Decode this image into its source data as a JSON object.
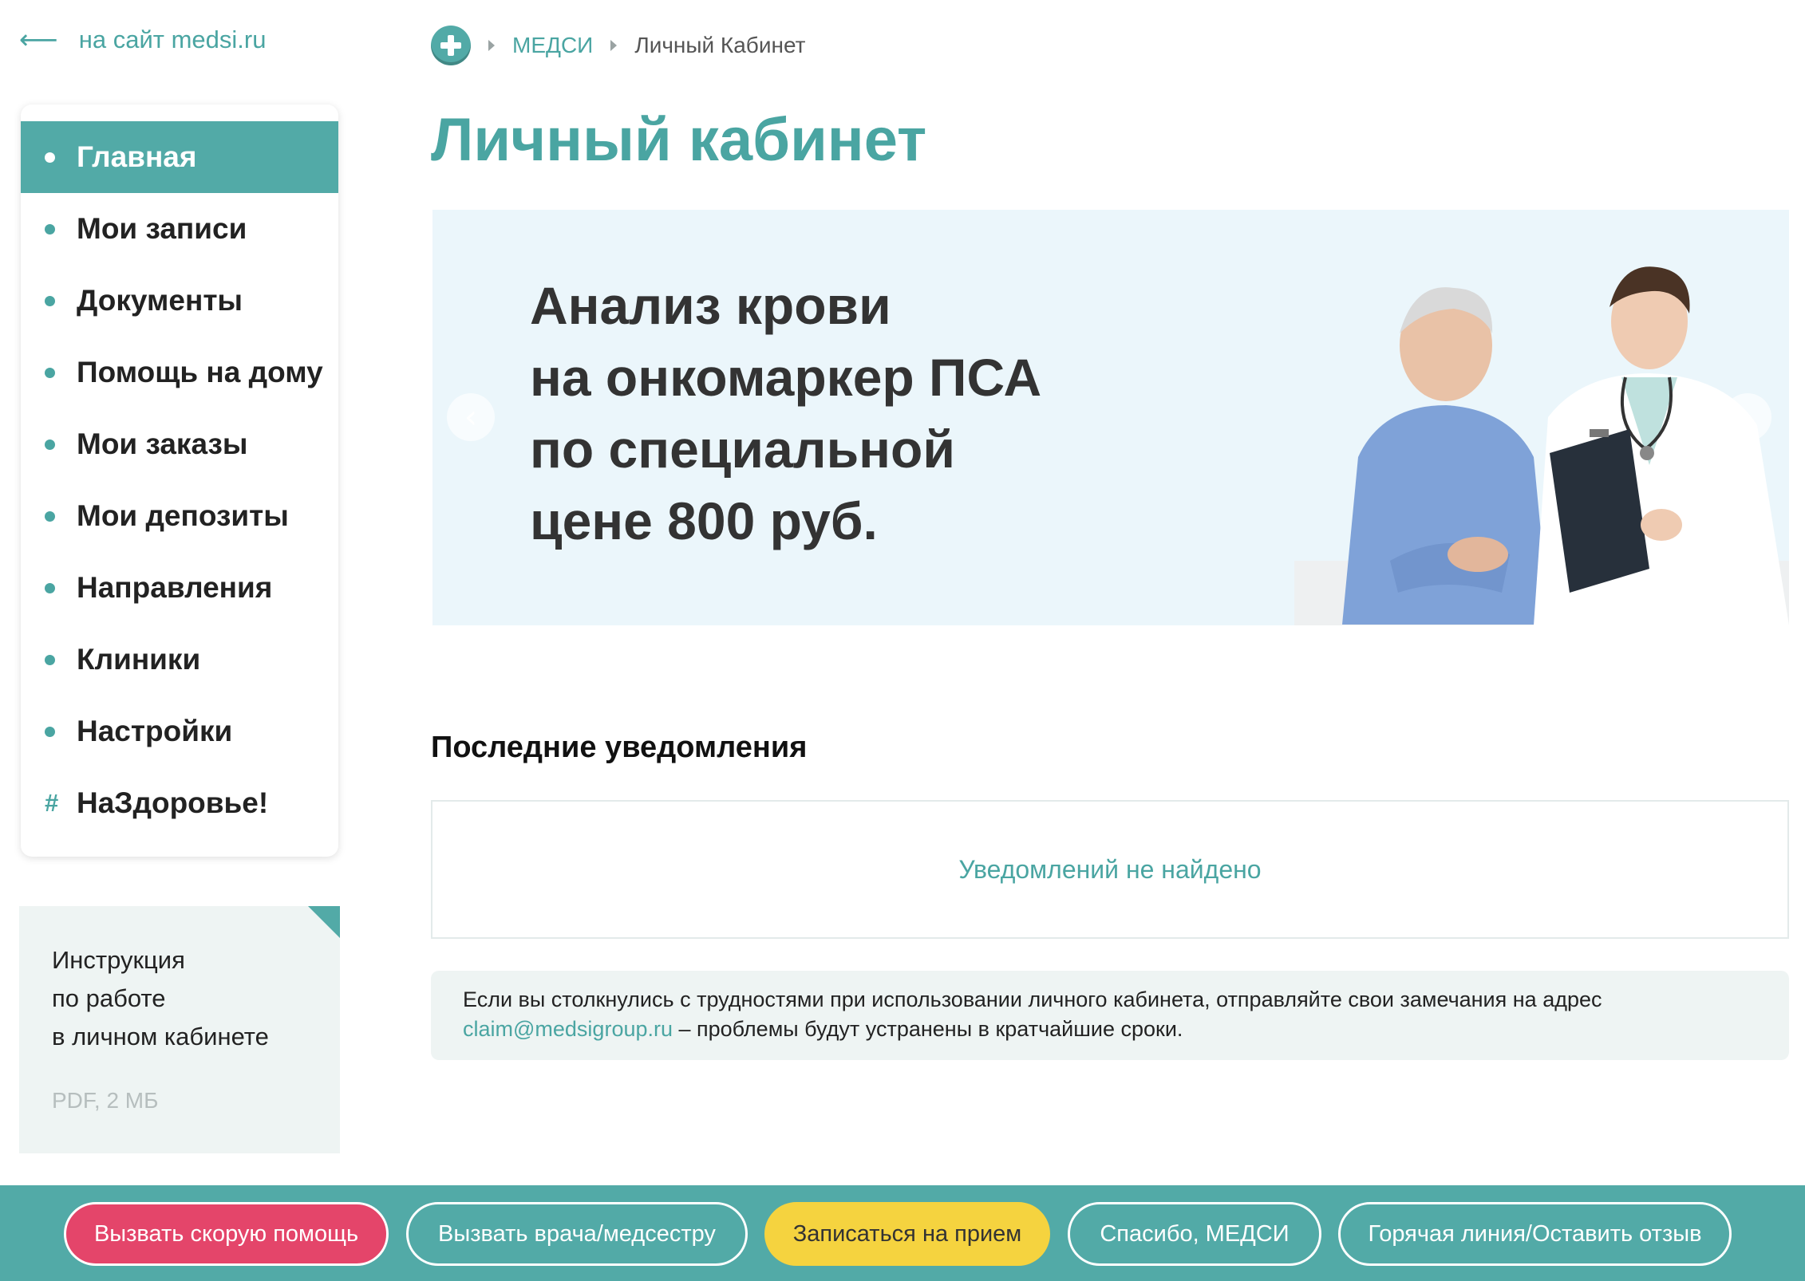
{
  "header": {
    "back_arrow": "⟵",
    "back_link": "на сайт medsi.ru"
  },
  "breadcrumb": {
    "home_icon": "plus-circle-icon",
    "items": [
      "МЕДСИ",
      "Личный Кабинет"
    ]
  },
  "page_title": "Личный кабинет",
  "sidebar": {
    "items": [
      {
        "label": "Главная",
        "marker": "bullet",
        "active": true
      },
      {
        "label": "Мои записи",
        "marker": "bullet"
      },
      {
        "label": "Документы",
        "marker": "bullet"
      },
      {
        "label": "Помощь на дому",
        "marker": "bullet"
      },
      {
        "label": "Мои заказы",
        "marker": "bullet"
      },
      {
        "label": "Мои депозиты",
        "marker": "bullet"
      },
      {
        "label": "Направления",
        "marker": "bullet"
      },
      {
        "label": "Клиники",
        "marker": "bullet"
      },
      {
        "label": "Настройки",
        "marker": "bullet"
      },
      {
        "label": "НаЗдоровье!",
        "marker": "#"
      }
    ]
  },
  "instruction": {
    "lines": [
      "Инструкция",
      "по работе",
      "в личном кабинете"
    ],
    "meta": "PDF, 2 МБ"
  },
  "banner": {
    "lines": [
      "Анализ крови",
      "на онкомаркер ПСА",
      "по специальной",
      "цене 800 руб."
    ],
    "prev_icon": "‹",
    "next_icon": "›"
  },
  "notifications": {
    "title": "Последние уведомления",
    "empty_text": "Уведомлений не найдено"
  },
  "help": {
    "text_before": "Если вы столкнулись с трудностями при использовании личного кабинета, отправляйте свои замечания на адрес",
    "email": "claim@medsigroup.ru",
    "text_after": " – проблемы будут устранены в кратчайшие сроки."
  },
  "bottom_bar": {
    "emergency": "Вызвать скорую помощь",
    "call_doctor": "Вызвать врача/медсестру",
    "appointment": "Записаться на прием",
    "thanks": "Спасибо, МЕДСИ",
    "hotline": "Горячая линия/Оставить отзыв"
  },
  "colors": {
    "accent": "#52aaa7",
    "accent_text": "#4aa5a2",
    "emergency": "#e4456a",
    "appointment": "#f5d33f",
    "banner_bg": "#ebf6fb"
  }
}
